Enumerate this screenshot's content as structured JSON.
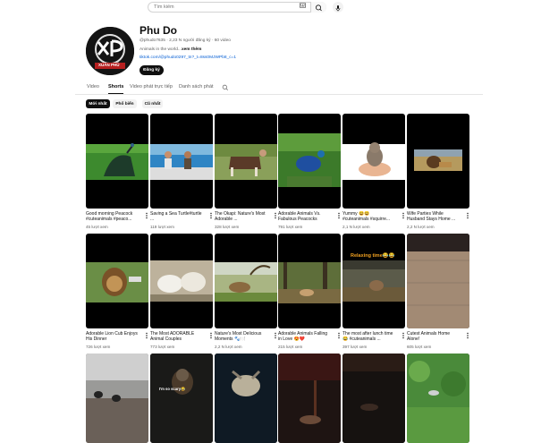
{
  "search": {
    "placeholder": "Tìm kiếm"
  },
  "channel": {
    "name": "Phu Do",
    "handle": "@phudo7635",
    "meta": "@phudo7635 · 2,23 N người đăng ký · 60 video",
    "description": "Animals in the world...",
    "more": "xem thêm",
    "link": "tiktok.com/@phudo0297_tn?_t=8ss0MJWPb8_c=1",
    "subscribe_label": "Đăng ký",
    "avatar_text": "XP",
    "avatar_sub": "XUÂN PHÚ"
  },
  "tabs": [
    {
      "label": "Video"
    },
    {
      "label": "Shorts",
      "active": true
    },
    {
      "label": "Video phát trực tiếp"
    },
    {
      "label": "Danh sách phát"
    }
  ],
  "chips": [
    {
      "label": "Mới nhất",
      "active": true
    },
    {
      "label": "Phổ biến"
    },
    {
      "label": "Cũ nhất"
    }
  ],
  "shorts": [
    {
      "title": "Good morning Peacock #cuteanimals #peaco...",
      "views": "45 lượt xem",
      "scene": "peacock-grass"
    },
    {
      "title": "Saving a Sea Turtle#turtle ...",
      "views": "119 lượt xem",
      "scene": "boat-sea"
    },
    {
      "title": "The Okapi: Nature's Most Adorable ...",
      "views": "328 lượt xem",
      "scene": "okapi"
    },
    {
      "title": "Adorable Animals Vs. Fabulous Peacocks",
      "views": "791 lượt xem",
      "scene": "peacock-blue"
    },
    {
      "title": "Yummy 😆😆 #cuteanimals #squirre...",
      "views": "2,1 N lượt xem",
      "scene": "squirrel"
    },
    {
      "title": "Wife Parties While Husband Stays Home ...",
      "views": "2,2 N lượt xem",
      "scene": "lion-small"
    },
    {
      "title": "Adorable Lion Cub Enjoys His Dinner",
      "views": "726 lượt xem",
      "scene": "lion-cub"
    },
    {
      "title": "The Most ADORABLE Animal Couples",
      "views": "773 lượt xem",
      "scene": "white-lions"
    },
    {
      "title": "Nature's Most Delicious Moments 🐾🍽️",
      "views": "2,2 N lượt xem",
      "scene": "savanna"
    },
    {
      "title": "Adorable Animals Falling in Love 😍❤️",
      "views": "215 lượt xem",
      "scene": "forest"
    },
    {
      "title": "The most after lunch time😂 #cuteanimals ...",
      "views": "397 lượt xem",
      "scene": "relaxing",
      "overlay": "Relaxing time😂😂"
    },
    {
      "title": "Cutest Animals Home Alone!",
      "views": "605 lượt xem",
      "scene": "cage"
    },
    {
      "scene": "birds-rocks"
    },
    {
      "scene": "otter",
      "overlay": "I'm so scary😂"
    },
    {
      "scene": "turtle-dark"
    },
    {
      "scene": "night-red"
    },
    {
      "scene": "night-dark"
    },
    {
      "scene": "green-bird"
    }
  ],
  "colors": {
    "accent": "#0f0f0f",
    "link": "#065fd4",
    "muted": "#606060",
    "chip": "#f2f2f2"
  }
}
